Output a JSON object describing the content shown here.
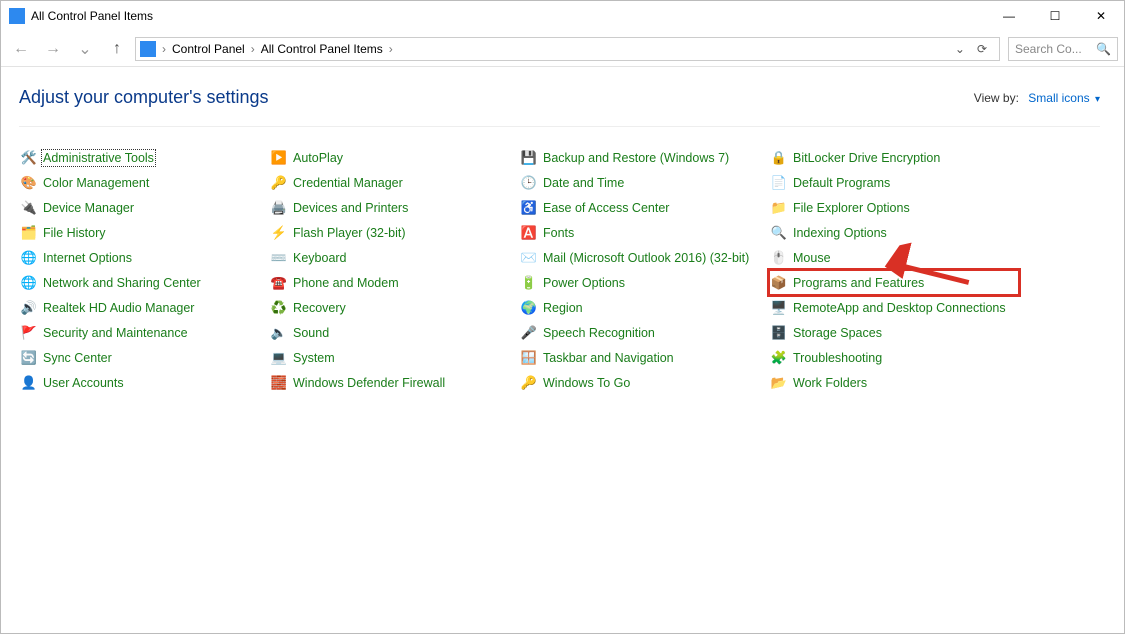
{
  "window": {
    "title": "All Control Panel Items",
    "minimize_glyph": "—",
    "maximize_glyph": "☐",
    "close_glyph": "✕"
  },
  "nav": {
    "back_glyph": "←",
    "forward_glyph": "→",
    "up_glyph": "↑",
    "dropdown_glyph": "⌄",
    "refresh_glyph": "⟳"
  },
  "breadcrumb": {
    "root": "Control Panel",
    "current": "All Control Panel Items",
    "sep": "›"
  },
  "search": {
    "placeholder": "Search Co...",
    "icon": "🔍"
  },
  "header": {
    "title": "Adjust your computer's settings",
    "viewby_label": "View by:",
    "viewby_value": "Small icons",
    "caret": "▾"
  },
  "icons": {
    "administrative-tools": "🛠️",
    "autoplay": "▶️",
    "backup-restore": "💾",
    "bitlocker": "🔒",
    "color-management": "🎨",
    "credential-manager": "🔑",
    "date-time": "🕒",
    "default-programs": "📄",
    "device-manager": "🔌",
    "devices-printers": "🖨️",
    "ease-of-access": "♿",
    "file-explorer-options": "📁",
    "file-history": "🗂️",
    "flash-player": "⚡",
    "fonts": "🅰️",
    "indexing-options": "🔍",
    "internet-options": "🌐",
    "keyboard": "⌨️",
    "mail": "✉️",
    "mouse": "🖱️",
    "network-sharing": "🌐",
    "phone-modem": "☎️",
    "power-options": "🔋",
    "programs-features": "📦",
    "realtek": "🔊",
    "recovery": "♻️",
    "region": "🌍",
    "remoteapp": "🖥️",
    "security-maintenance": "🚩",
    "sound": "🔈",
    "speech-recognition": "🎤",
    "storage-spaces": "🗄️",
    "sync-center": "🔄",
    "system": "💻",
    "taskbar-navigation": "🪟",
    "troubleshooting": "🧩",
    "user-accounts": "👤",
    "windows-defender": "🧱",
    "windows-to-go": "🔑",
    "work-folders": "📂"
  },
  "items": [
    {
      "key": "administrative-tools",
      "label": "Administrative Tools",
      "selected": true
    },
    {
      "key": "autoplay",
      "label": "AutoPlay"
    },
    {
      "key": "backup-restore",
      "label": "Backup and Restore (Windows 7)"
    },
    {
      "key": "bitlocker",
      "label": "BitLocker Drive Encryption"
    },
    {
      "key": "color-management",
      "label": "Color Management"
    },
    {
      "key": "credential-manager",
      "label": "Credential Manager"
    },
    {
      "key": "date-time",
      "label": "Date and Time"
    },
    {
      "key": "default-programs",
      "label": "Default Programs"
    },
    {
      "key": "device-manager",
      "label": "Device Manager"
    },
    {
      "key": "devices-printers",
      "label": "Devices and Printers"
    },
    {
      "key": "ease-of-access",
      "label": "Ease of Access Center"
    },
    {
      "key": "file-explorer-options",
      "label": "File Explorer Options"
    },
    {
      "key": "file-history",
      "label": "File History"
    },
    {
      "key": "flash-player",
      "label": "Flash Player (32-bit)"
    },
    {
      "key": "fonts",
      "label": "Fonts"
    },
    {
      "key": "indexing-options",
      "label": "Indexing Options"
    },
    {
      "key": "internet-options",
      "label": "Internet Options"
    },
    {
      "key": "keyboard",
      "label": "Keyboard"
    },
    {
      "key": "mail",
      "label": "Mail (Microsoft Outlook 2016) (32-bit)"
    },
    {
      "key": "mouse",
      "label": "Mouse"
    },
    {
      "key": "network-sharing",
      "label": "Network and Sharing Center"
    },
    {
      "key": "phone-modem",
      "label": "Phone and Modem"
    },
    {
      "key": "power-options",
      "label": "Power Options"
    },
    {
      "key": "programs-features",
      "label": "Programs and Features",
      "highlighted": true
    },
    {
      "key": "realtek",
      "label": "Realtek HD Audio Manager"
    },
    {
      "key": "recovery",
      "label": "Recovery"
    },
    {
      "key": "region",
      "label": "Region"
    },
    {
      "key": "remoteapp",
      "label": "RemoteApp and Desktop Connections"
    },
    {
      "key": "security-maintenance",
      "label": "Security and Maintenance"
    },
    {
      "key": "sound",
      "label": "Sound"
    },
    {
      "key": "speech-recognition",
      "label": "Speech Recognition"
    },
    {
      "key": "storage-spaces",
      "label": "Storage Spaces"
    },
    {
      "key": "sync-center",
      "label": "Sync Center"
    },
    {
      "key": "system",
      "label": "System"
    },
    {
      "key": "taskbar-navigation",
      "label": "Taskbar and Navigation"
    },
    {
      "key": "troubleshooting",
      "label": "Troubleshooting"
    },
    {
      "key": "user-accounts",
      "label": "User Accounts"
    },
    {
      "key": "windows-defender",
      "label": "Windows Defender Firewall"
    },
    {
      "key": "windows-to-go",
      "label": "Windows To Go"
    },
    {
      "key": "work-folders",
      "label": "Work Folders"
    }
  ]
}
